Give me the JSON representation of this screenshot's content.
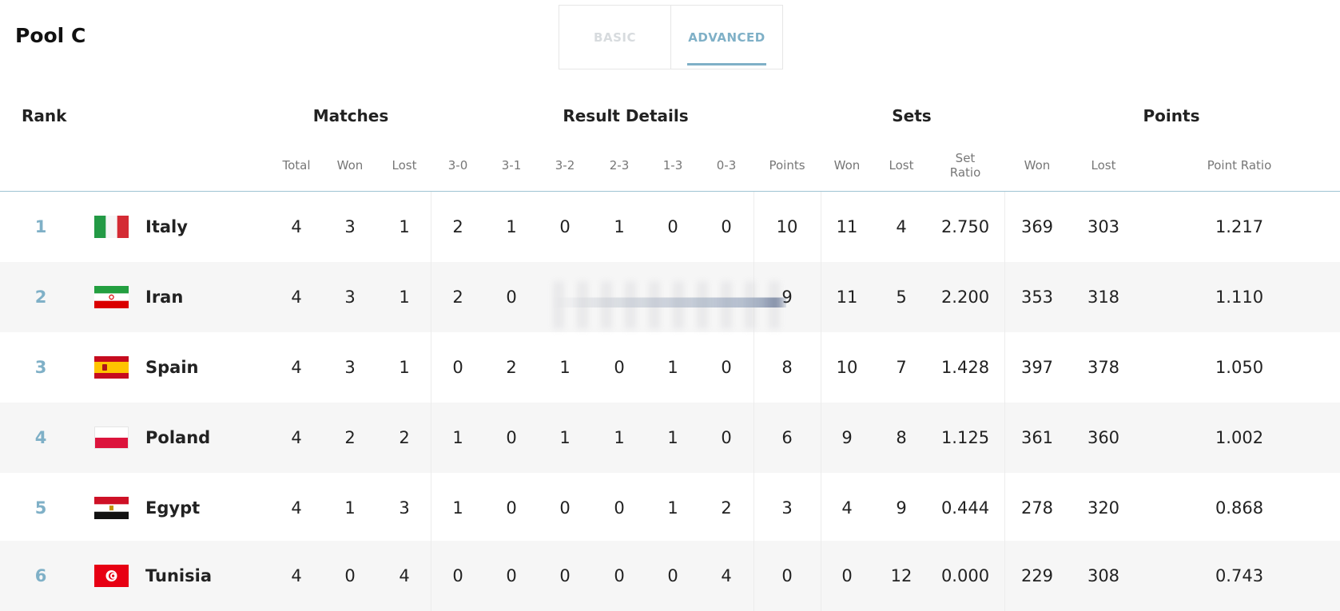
{
  "pool_title": "Pool C",
  "tabs": [
    {
      "label": "BASIC",
      "active": false
    },
    {
      "label": "ADVANCED",
      "active": true
    }
  ],
  "groups": {
    "rank": "Rank",
    "matches": "Matches",
    "result_details": "Result Details",
    "sets": "Sets",
    "points": "Points"
  },
  "columns": {
    "total": "Total",
    "won": "Won",
    "lost": "Lost",
    "r30": "3-0",
    "r31": "3-1",
    "r32": "3-2",
    "r23": "2-3",
    "r13": "1-3",
    "r03": "0-3",
    "points": "Points",
    "sets_won": "Won",
    "sets_lost": "Lost",
    "set_ratio_1": "Set",
    "set_ratio_2": "Ratio",
    "points_won": "Won",
    "points_lost": "Lost",
    "point_ratio": "Point Ratio"
  },
  "colors": {
    "accent": "#7fb0c7",
    "row_alt": "#f6f6f6"
  },
  "rows": [
    {
      "rank": "1",
      "team": "Italy",
      "flag": "italy-flag",
      "total": "4",
      "won": "3",
      "lost": "1",
      "r30": "2",
      "r31": "1",
      "r32": "0",
      "r23": "1",
      "r13": "0",
      "r03": "0",
      "points": "10",
      "sets_won": "11",
      "sets_lost": "4",
      "set_ratio": "2.750",
      "points_won": "369",
      "points_lost": "303",
      "point_ratio": "1.217"
    },
    {
      "rank": "2",
      "team": "Iran",
      "flag": "iran-flag",
      "total": "4",
      "won": "3",
      "lost": "1",
      "r30": "2",
      "r31": "0",
      "points": "9",
      "sets_won": "11",
      "sets_lost": "5",
      "set_ratio": "2.200",
      "points_won": "353",
      "points_lost": "318",
      "point_ratio": "1.110"
    },
    {
      "rank": "3",
      "team": "Spain",
      "flag": "spain-flag",
      "total": "4",
      "won": "3",
      "lost": "1",
      "r30": "0",
      "r31": "2",
      "r32": "1",
      "r23": "0",
      "r13": "1",
      "r03": "0",
      "points": "8",
      "sets_won": "10",
      "sets_lost": "7",
      "set_ratio": "1.428",
      "points_won": "397",
      "points_lost": "378",
      "point_ratio": "1.050"
    },
    {
      "rank": "4",
      "team": "Poland",
      "flag": "poland-flag",
      "total": "4",
      "won": "2",
      "lost": "2",
      "r30": "1",
      "r31": "0",
      "r32": "1",
      "r23": "1",
      "r13": "1",
      "r03": "0",
      "points": "6",
      "sets_won": "9",
      "sets_lost": "8",
      "set_ratio": "1.125",
      "points_won": "361",
      "points_lost": "360",
      "point_ratio": "1.002"
    },
    {
      "rank": "5",
      "team": "Egypt",
      "flag": "egypt-flag",
      "total": "4",
      "won": "1",
      "lost": "3",
      "r30": "1",
      "r31": "0",
      "r32": "0",
      "r23": "0",
      "r13": "1",
      "r03": "2",
      "points": "3",
      "sets_won": "4",
      "sets_lost": "9",
      "set_ratio": "0.444",
      "points_won": "278",
      "points_lost": "320",
      "point_ratio": "0.868"
    },
    {
      "rank": "6",
      "team": "Tunisia",
      "flag": "tunisia-flag",
      "total": "4",
      "won": "0",
      "lost": "4",
      "r30": "0",
      "r31": "0",
      "r32": "0",
      "r23": "0",
      "r13": "0",
      "r03": "4",
      "points": "0",
      "sets_won": "0",
      "sets_lost": "12",
      "set_ratio": "0.000",
      "points_won": "229",
      "points_lost": "308",
      "point_ratio": "0.743"
    }
  ]
}
